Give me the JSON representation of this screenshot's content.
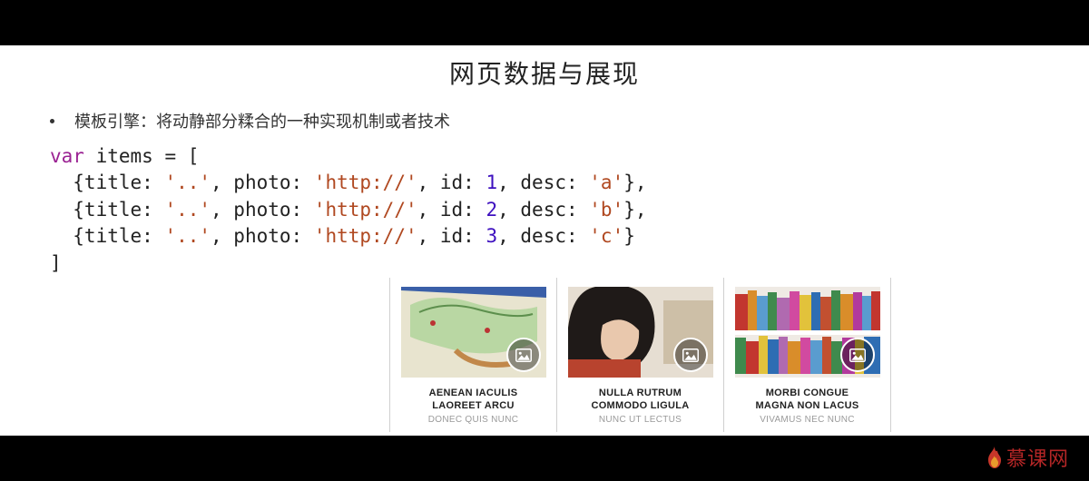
{
  "slide": {
    "title": "网页数据与展现",
    "bullet": "模板引擎：将动静部分糅合的一种实现机制或者技术"
  },
  "code": {
    "kw_var": "var",
    "var_name": "items",
    "eq_bracket": " = [",
    "line_prefix": "  {title: ",
    "str_title": "'..'",
    "photo_key": ", photo: ",
    "str_photo": "'http://'",
    "id_key": ", id: ",
    "ids": [
      "1",
      "2",
      "3"
    ],
    "desc_key": ", desc: ",
    "descs": [
      "'a'",
      "'b'",
      "'c'"
    ],
    "close_obj": "},",
    "close_obj_last": "}",
    "close_arr": "]"
  },
  "cards": [
    {
      "title_l1": "AENEAN IACULIS",
      "title_l2": "LAOREET ARCU",
      "sub": "DONEC QUIS NUNC"
    },
    {
      "title_l1": "NULLA RUTRUM",
      "title_l2": "COMMODO LIGULA",
      "sub": "NUNC UT LECTUS"
    },
    {
      "title_l1": "MORBI CONGUE",
      "title_l2": "MAGNA NON LACUS",
      "sub": "VIVAMUS NEC NUNC"
    }
  ],
  "watermark": "慕课网"
}
